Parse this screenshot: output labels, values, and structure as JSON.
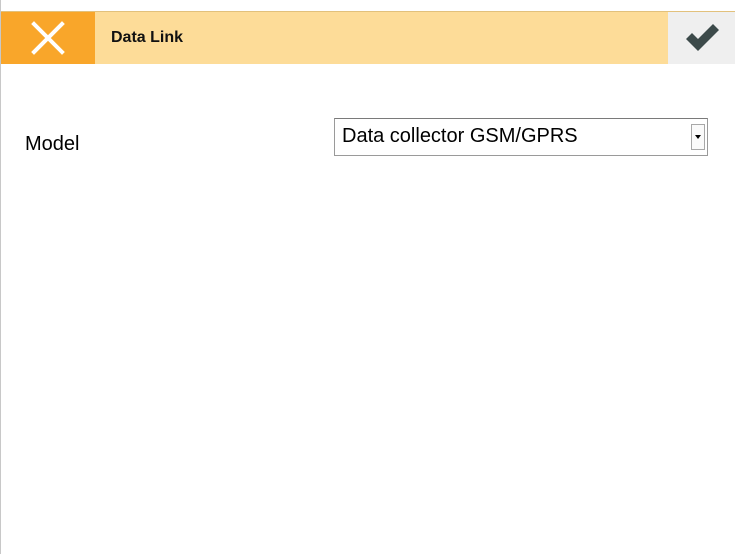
{
  "window": {
    "title": "Data Link",
    "close_icon": "close-icon",
    "confirm_icon": "checkmark-icon"
  },
  "form": {
    "model_label": "Model",
    "model_value": "Data collector GSM/GPRS"
  },
  "colors": {
    "close_button": "#f9a62a",
    "titlebar": "#fddc98",
    "confirm_button": "#efefef",
    "checkmark": "#3c4a4a"
  }
}
